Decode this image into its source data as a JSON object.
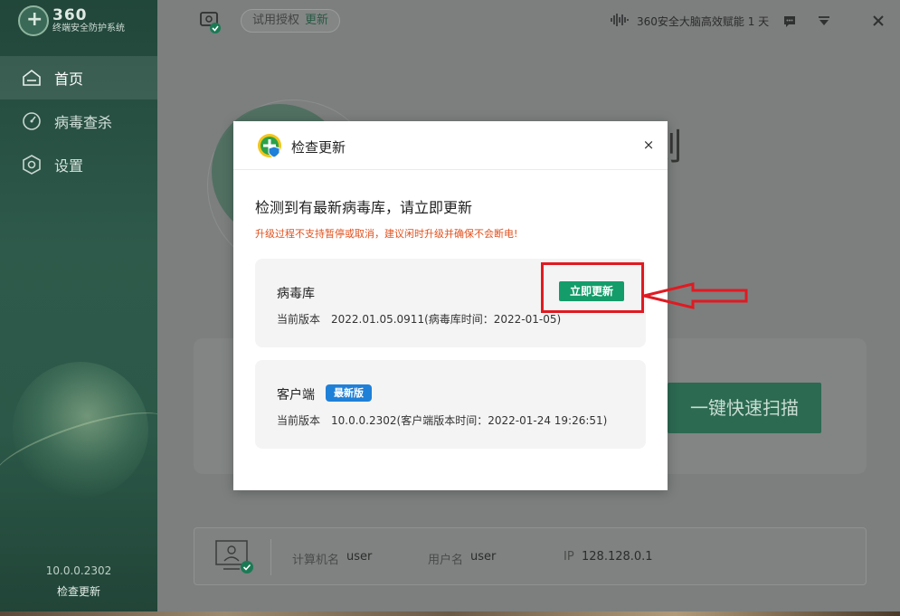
{
  "sidebar": {
    "logo_big": "360",
    "logo_small": "终端安全防护系统",
    "items": [
      {
        "label": "首页",
        "icon": "home-icon",
        "active": true
      },
      {
        "label": "病毒查杀",
        "icon": "scan-icon",
        "active": false
      },
      {
        "label": "设置",
        "icon": "settings-icon",
        "active": false
      }
    ],
    "version": "10.0.0.2302",
    "check_update": "检查更新"
  },
  "topbar": {
    "trial": "试用授权",
    "trial_update": "更新",
    "brain_text": "360安全大脑高效赋能 1 天"
  },
  "main": {
    "heading_visible": "刻",
    "scan_button": "一键快速扫描",
    "info": {
      "computer_label": "计算机名",
      "computer_value": "user",
      "user_label": "用户名",
      "user_value": "user",
      "ip_label": "IP",
      "ip_value": "128.128.0.1"
    }
  },
  "modal": {
    "title": "检查更新",
    "close": "×",
    "headline": "检测到有最新病毒库，请立即更新",
    "warning": "升级过程不支持暂停或取消，建议闲时升级并确保不会断电!",
    "virus_db": {
      "name": "病毒库",
      "version_label": "当前版本",
      "version_value": "2022.01.05.0911(病毒库时间：2022-01-05)",
      "update_button": "立即更新"
    },
    "client": {
      "name": "客户端",
      "badge": "最新版",
      "version_label": "当前版本",
      "version_value": "10.0.0.2302(客户端版本时间：2022-01-24 19:26:51)"
    }
  },
  "colors": {
    "sidebar_green": "#2e5a4b",
    "update_green": "#149c6a",
    "badge_blue": "#1f80d8",
    "warning_orange": "#e0521f",
    "annotation_red": "#e01a22"
  }
}
